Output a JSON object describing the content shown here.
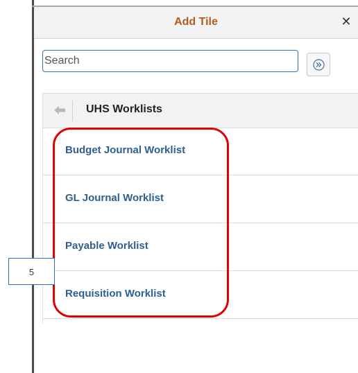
{
  "dialog": {
    "title": "Add Tile",
    "close_glyph": "✕"
  },
  "search": {
    "placeholder": "Search",
    "value": ""
  },
  "panel": {
    "title": "UHS Worklists",
    "items": [
      {
        "label": "Budget Journal Worklist"
      },
      {
        "label": "GL Journal Worklist"
      },
      {
        "label": "Payable Worklist"
      },
      {
        "label": "Requisition Worklist"
      }
    ]
  },
  "annotation": {
    "callout_number": "5",
    "highlight_color": "#e00000"
  },
  "colors": {
    "title": "#b25b1f",
    "link": "#2d5f8f",
    "input_border": "#2f6fae"
  },
  "icons": {
    "close": "close-icon",
    "go": "double-chevron-right-icon",
    "back": "back-arrow-icon"
  }
}
